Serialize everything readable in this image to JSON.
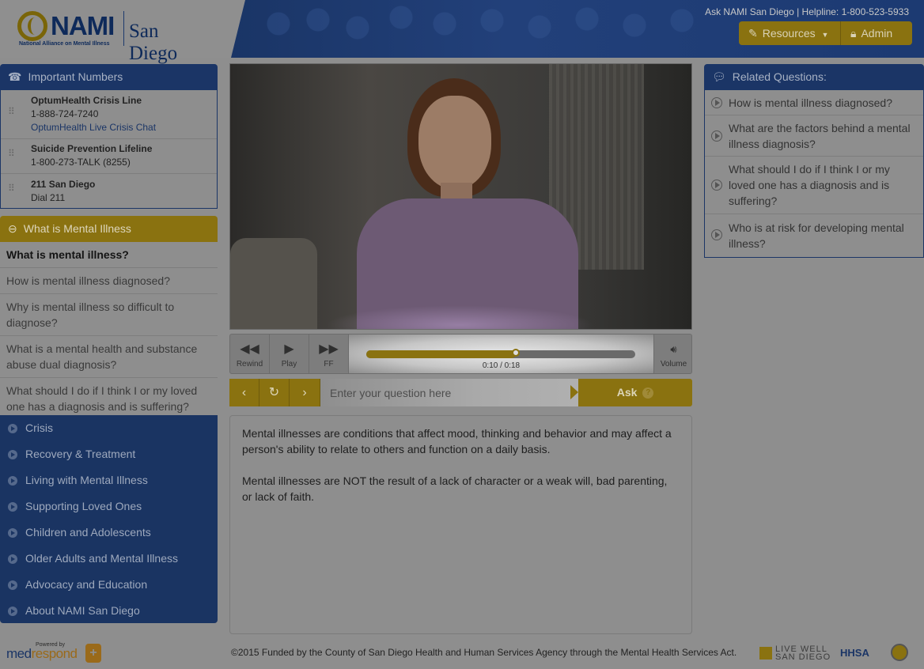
{
  "header": {
    "logo_word": "NAMI",
    "logo_tagline": "National Alliance on Mental Illness",
    "logo_city": "San Diego",
    "helpline": "Ask NAMI San Diego | Helpline: 1-800-523-5933",
    "resources_label": "Resources",
    "admin_label": "Admin"
  },
  "important_numbers": {
    "title": "Important Numbers",
    "entries": [
      {
        "name": "OptumHealth Crisis Line",
        "line": "1-888-724-7240",
        "link": "OptumHealth Live Crisis Chat"
      },
      {
        "name": "Suicide Prevention Lifeline",
        "line": "1-800-273-TALK (8255)"
      },
      {
        "name": "211 San Diego",
        "line": "Dial 211"
      }
    ]
  },
  "mental_illness": {
    "title": "What is Mental Illness",
    "items": [
      "What is mental illness?",
      "How is mental illness diagnosed?",
      "Why is mental illness so difficult to diagnose?",
      "What is a mental health and substance abuse dual diagnosis?",
      "What should I do if I think I or my loved one has a diagnosis and is suffering?"
    ],
    "active_index": 0
  },
  "categories": [
    "Crisis",
    "Recovery & Treatment",
    "Living with Mental Illness",
    "Supporting Loved Ones",
    "Children and Adolescents",
    "Older Adults and Mental Illness",
    "Advocacy and Education",
    "About NAMI San Diego"
  ],
  "player": {
    "rewind_label": "Rewind",
    "play_label": "Play",
    "ff_label": "FF",
    "volume_label": "Volume",
    "time_display": "0:10 / 0:18",
    "progress": 0.5556
  },
  "ask": {
    "placeholder": "Enter your question here",
    "button_label": "Ask"
  },
  "answer": {
    "paragraphs": [
      "Mental illnesses are conditions that affect mood, thinking and behavior and may affect a person's ability to relate to others and function on a daily basis.",
      "Mental illnesses are NOT the result of a lack of character or a weak will, bad parenting, or lack of faith."
    ]
  },
  "related": {
    "title": "Related Questions:",
    "items": [
      "How is mental illness diagnosed?",
      "What are the factors behind a mental illness diagnosis?",
      "What should I do if I think I or my loved one has a diagnosis and is suffering?",
      "Who is at risk for developing mental illness?"
    ]
  },
  "footer": {
    "powered_by": "Powered by",
    "brand_prefix": "med",
    "brand_suffix": "respond",
    "copyright": "©2015 Funded by the County of San Diego Health and Human Services Agency through the Mental Health Services Act.",
    "livewell_line1": "LIVE WELL",
    "livewell_line2": "SAN DIEGO",
    "hhsa": "HHSA"
  },
  "colors": {
    "navy": "#1b3566",
    "gold": "#8a7210",
    "overlay_gray": "#8e8e8e"
  },
  "icons": {
    "phone": "phone-icon",
    "chat": "chat-bubble-icon",
    "pencil": "pencil-icon",
    "lock": "lock-icon",
    "keypad": "keypad-icon"
  }
}
